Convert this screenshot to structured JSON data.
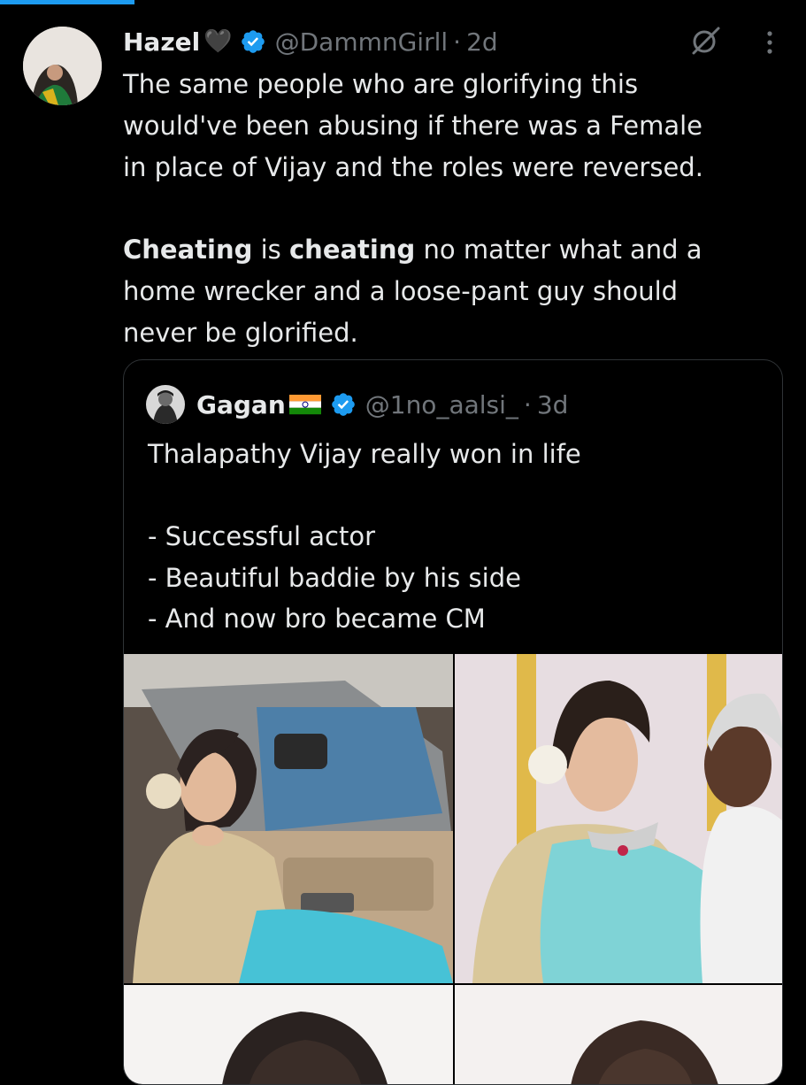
{
  "post": {
    "author_name": "Hazel",
    "name_emoji": "🖤",
    "handle": "@DammnGirll",
    "separator": "·",
    "time": "2d",
    "text": {
      "line1": "The same people who are glorifying this",
      "line2": "would've been abusing if there was a Female",
      "line3": "in place of Vijay and the roles were reversed.",
      "p2_bold1": "Cheating",
      "p2_mid1": " is ",
      "p2_bold2": "cheating",
      "p2_rest": " no matter what and a",
      "line5": "home wrecker and a loose-pant guy should",
      "line6": "never be glorified."
    }
  },
  "quote": {
    "author_name": "Gagan",
    "handle": "@1no_aalsi_",
    "separator": "·",
    "time": "3d",
    "lines": {
      "line1": "Thalapathy Vijay really won in life",
      "line2": "- Successful actor",
      "line3": "- Beautiful baddie by his side",
      "line4": "- And now bro became CM"
    }
  },
  "icons": {
    "verified": "verified-badge-icon",
    "grok": "grok-icon",
    "more": "more-vertical-icon",
    "flag": "india-flag-icon"
  },
  "colors": {
    "background": "#000000",
    "text": "#e7e9ea",
    "muted": "#71767b",
    "accent": "#1d9bf0",
    "border": "#2f3336"
  }
}
